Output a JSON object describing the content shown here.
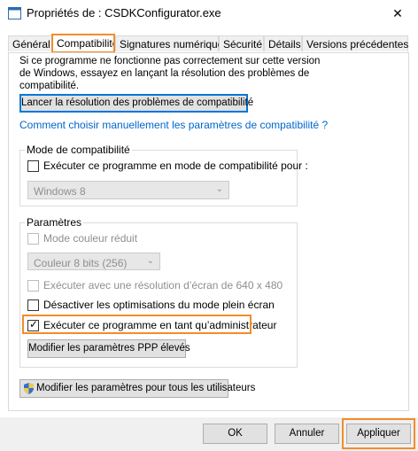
{
  "window": {
    "title": "Propriétés de : CSDKConfigurator.exe",
    "close_glyph": "✕",
    "icon": "app-window-icon"
  },
  "tabs": [
    {
      "label": "Général",
      "active": false
    },
    {
      "label": "Compatibilité",
      "active": true
    },
    {
      "label": "Signatures numériques",
      "active": false
    },
    {
      "label": "Sécurité",
      "active": false
    },
    {
      "label": "Détails",
      "active": false
    },
    {
      "label": "Versions précédentes",
      "active": false
    }
  ],
  "intro": {
    "line1": "Si ce programme ne fonctionne pas correctement sur cette version",
    "line2": "de Windows, essayez en lançant la résolution des problèmes de",
    "line3": "compatibilité."
  },
  "troubleshoot_button": "Lancer la résolution des problèmes de compatibilité",
  "manual_link": "Comment choisir manuellement les paramètres de compatibilité ?",
  "compat_mode": {
    "group_label": "Mode de compatibilité",
    "checkbox_label": "Exécuter ce programme en mode de compatibilité pour :",
    "checked": false,
    "select_value": "Windows 8"
  },
  "settings": {
    "group_label": "Paramètres",
    "reduced_color_label": "Mode couleur réduit",
    "color_select_value": "Couleur 8 bits (256)",
    "res_640_label": "Exécuter avec une résolution d’écran de 640 x 480",
    "disable_fullscreen_label": "Désactiver les optimisations du mode plein écran",
    "run_as_admin_label": "Exécuter ce programme en tant qu’administrateur",
    "run_as_admin_checked": true,
    "high_dpi_button": "Modifier les paramètres PPP élevés"
  },
  "all_users_button": "Modifier les paramètres pour tous les utilisateurs",
  "footer": {
    "ok": "OK",
    "cancel": "Annuler",
    "apply": "Appliquer"
  },
  "colors": {
    "highlight": "#f28d2b",
    "focus": "#0078d7",
    "link": "#0066cc"
  }
}
